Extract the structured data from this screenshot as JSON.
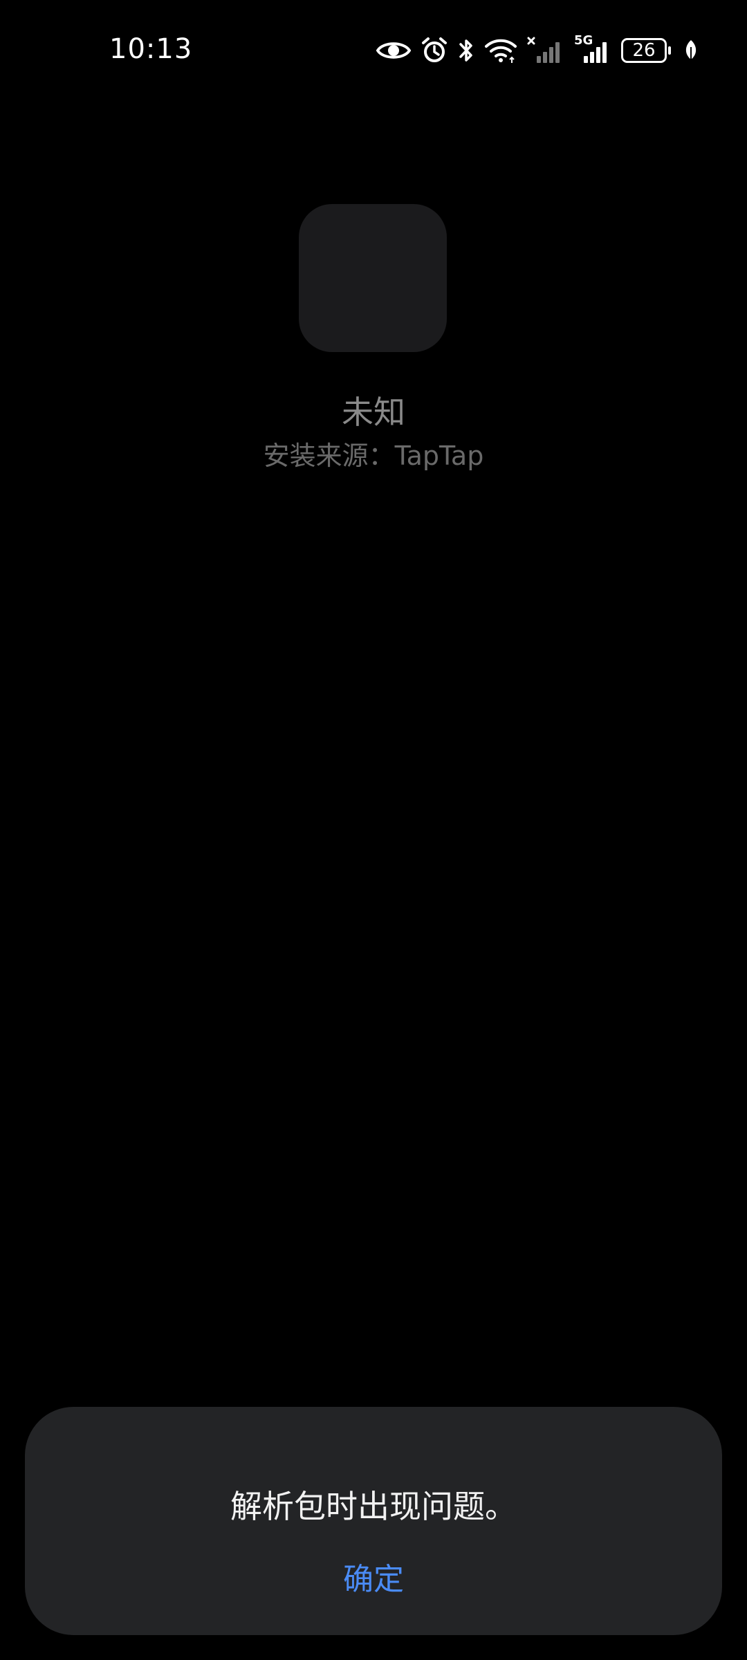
{
  "status_bar": {
    "time": "10:13",
    "battery_level": "26",
    "network_label": "5G",
    "icons": [
      "eye-icon",
      "alarm-icon",
      "bluetooth-icon",
      "wifi-icon",
      "signal-no-service-icon",
      "signal-5g-icon",
      "battery-icon",
      "leaf-icon"
    ]
  },
  "app": {
    "name": "未知",
    "install_source": "安装来源：TapTap"
  },
  "dialog": {
    "message": "解析包时出现问题。",
    "confirm_label": "确定",
    "confirm_color": "#4a8bf5"
  }
}
